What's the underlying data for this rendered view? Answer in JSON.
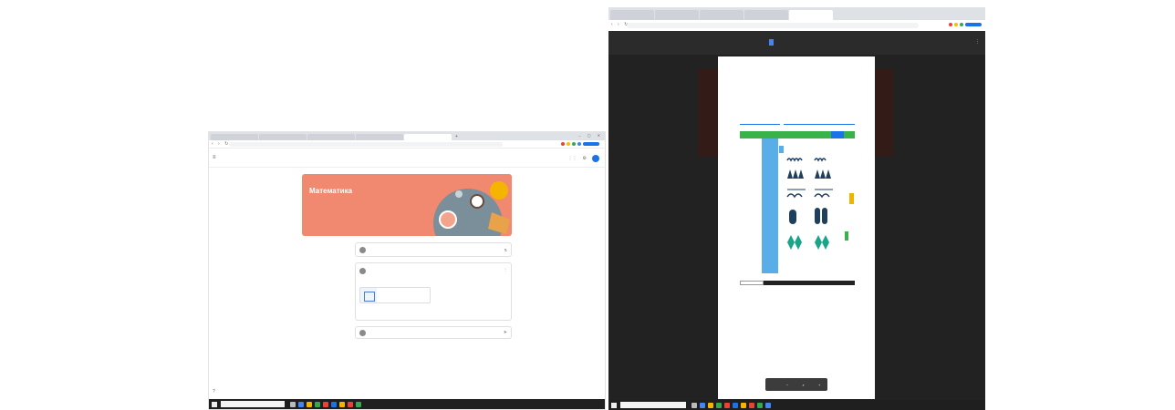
{
  "left": {
    "browser": {
      "tabs": [
        "",
        "",
        "",
        "",
        "",
        ""
      ],
      "address": "",
      "window_controls": "– ▢ ✕"
    },
    "classroom": {
      "brand": "",
      "tabs": [
        {
          "label": ""
        },
        {
          "label": ""
        },
        {
          "label": ""
        },
        {
          "label": ""
        }
      ],
      "banner": {
        "title": "Математика",
        "subtitle": ""
      },
      "aside": {
        "title": "",
        "line": "",
        "link": ""
      },
      "announce_placeholder": "",
      "post": {
        "author": "",
        "date": "",
        "body": "",
        "attachment_name": "",
        "attachment_type": ""
      },
      "comment_placeholder": ""
    },
    "taskbar": {
      "search": "",
      "clock": ""
    }
  },
  "right": {
    "browser": {
      "tabs": [
        "",
        "",
        "",
        "",
        ""
      ],
      "address": ""
    },
    "viewer": {
      "left_label": "",
      "doc_title": ""
    },
    "page": {
      "title_line1": "",
      "title_line2": ""
    },
    "zoom": {
      "label": "",
      "minus": "−",
      "plus": "+"
    },
    "taskbar": {
      "search": "",
      "clock": ""
    }
  },
  "colors": {
    "banner": "#f0896f",
    "accent_blue": "#1a73e8",
    "green_bar": "#38b249",
    "viewer_bg": "#222222"
  }
}
